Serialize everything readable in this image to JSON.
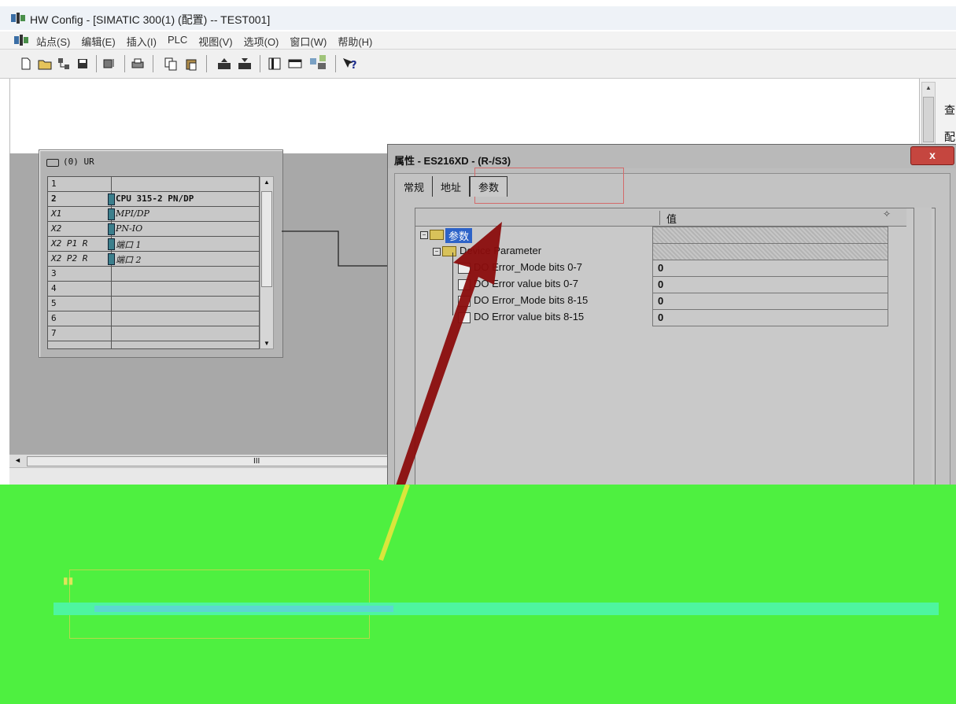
{
  "window": {
    "title": "HW Config - [SIMATIC 300(1) (配置) -- TEST001]"
  },
  "menu": {
    "items": [
      "站点(S)",
      "编辑(E)",
      "插入(I)",
      "PLC",
      "视图(V)",
      "选项(O)",
      "窗口(W)",
      "帮助(H)"
    ]
  },
  "right_panel": {
    "text1": "查",
    "text2": "配"
  },
  "rack": {
    "title": "(0) UR",
    "rows": [
      {
        "slot": "1",
        "module": ""
      },
      {
        "slot": "2",
        "module": "CPU 315-2 PN/DP"
      },
      {
        "slot": "X1",
        "module": "MPI/DP"
      },
      {
        "slot": "X2",
        "module": "PN-IO"
      },
      {
        "slot": "X2 P1 R",
        "module": "端口 1"
      },
      {
        "slot": "X2 P2 R",
        "module": "端口 2"
      },
      {
        "slot": "3",
        "module": ""
      },
      {
        "slot": "4",
        "module": ""
      },
      {
        "slot": "5",
        "module": ""
      },
      {
        "slot": "6",
        "module": ""
      },
      {
        "slot": "7",
        "module": ""
      }
    ]
  },
  "hscroll": {
    "grip": "III"
  },
  "dialog": {
    "title": "属性 - ES216XD - (R-/S3)",
    "close": "x",
    "tabs": [
      "常规",
      "地址",
      "参数"
    ],
    "active_tab": "参数",
    "value_header": "值",
    "tree": {
      "root": "参数",
      "group": "Device Parameter",
      "params": [
        {
          "name": "DO Error_Mode bits 0-7",
          "value": "0"
        },
        {
          "name": "DO Error value bits 0-7",
          "value": "0"
        },
        {
          "name": "DO Error_Mode bits 8-15",
          "value": "0"
        },
        {
          "name": "DO Error value bits 8-15",
          "value": "0"
        }
      ]
    }
  },
  "colors": {
    "annotation_arrow": "#8b0d0d",
    "glitch_green": "#4ef040",
    "selection_blue": "#2d63c8"
  }
}
